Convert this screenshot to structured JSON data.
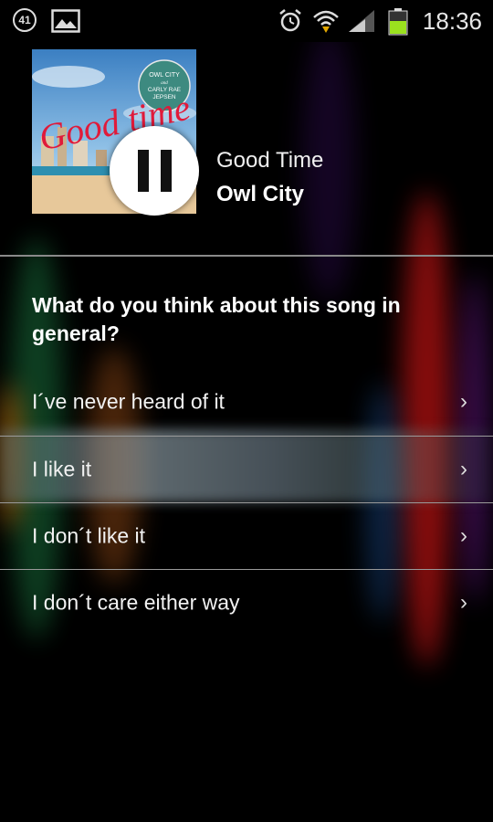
{
  "status_bar": {
    "notification_count": "41",
    "time": "18:36",
    "icons": [
      "notification-count-icon",
      "gallery-icon",
      "alarm-icon",
      "wifi-icon",
      "signal-icon",
      "battery-icon"
    ]
  },
  "now_playing": {
    "album_art": {
      "badge_line1": "OWL CITY",
      "badge_line2": "and",
      "badge_line3": "CARLY RAE",
      "badge_line4": "JEPSEN",
      "script_title": "Good time"
    },
    "title": "Good Time",
    "artist": "Owl City",
    "control_icon": "pause-icon"
  },
  "survey": {
    "question": "What do you think about this song in general?",
    "options": [
      {
        "label": "I´ve never heard of it"
      },
      {
        "label": "I like it"
      },
      {
        "label": "I don´t like it"
      },
      {
        "label": "I don´t care either way"
      }
    ],
    "chevron": "›"
  },
  "colors": {
    "background": "#000000",
    "text": "#ffffff",
    "divider": "#8a8a8a",
    "battery_green": "#9be21f"
  }
}
